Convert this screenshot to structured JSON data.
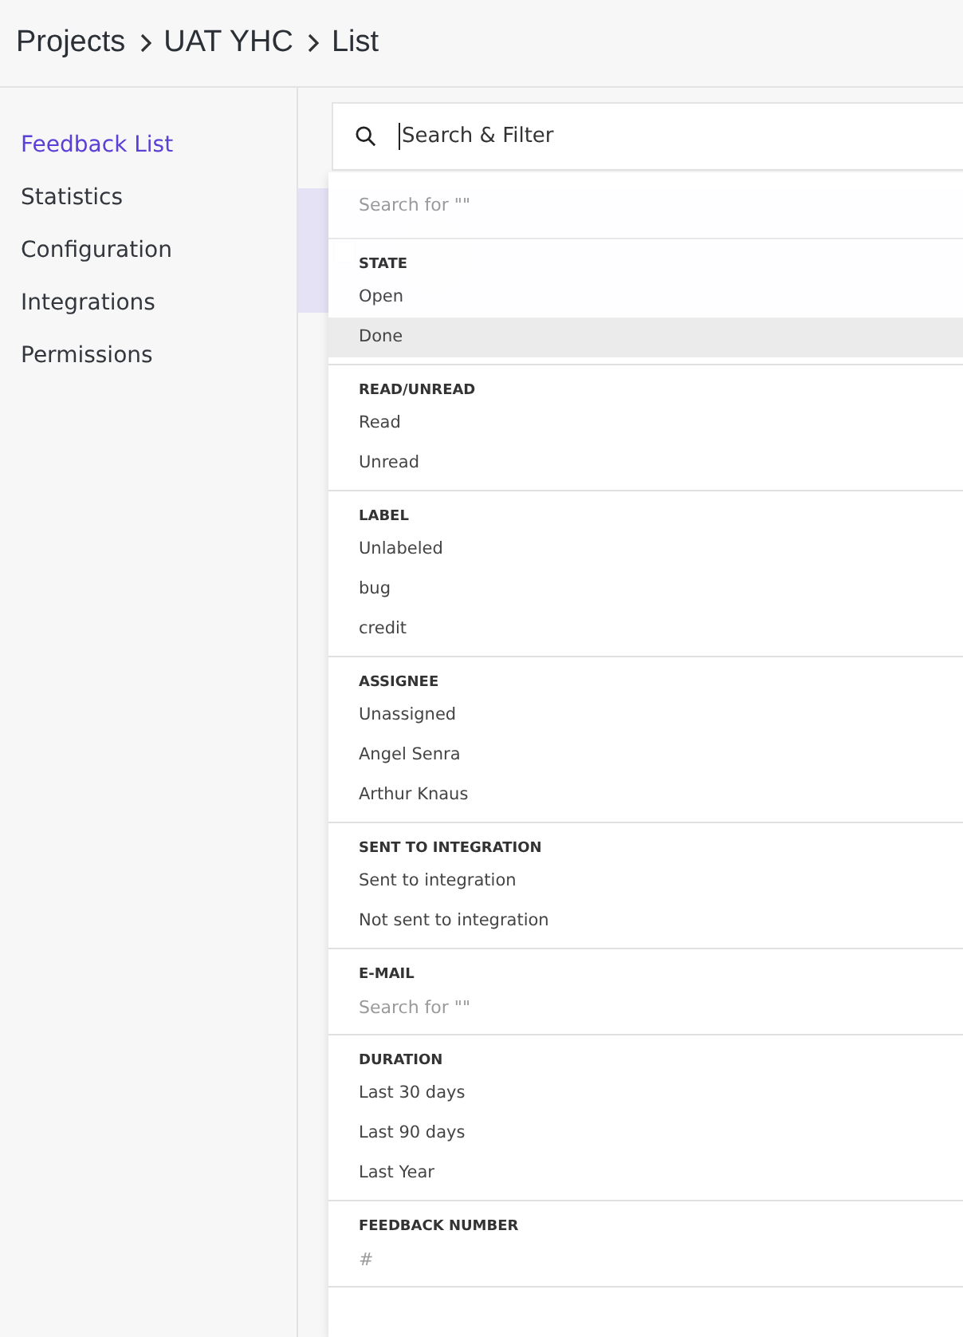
{
  "breadcrumb": [
    "Projects",
    "UAT YHC",
    "List"
  ],
  "sidebar": {
    "items": [
      {
        "label": "Feedback List",
        "selected": true
      },
      {
        "label": "Statistics",
        "selected": false
      },
      {
        "label": "Configuration",
        "selected": false
      },
      {
        "label": "Integrations",
        "selected": false
      },
      {
        "label": "Permissions",
        "selected": false
      }
    ]
  },
  "search": {
    "placeholder": "Search & Filter"
  },
  "dropdown": {
    "search_placeholder": "Search for \"\"",
    "sections": [
      {
        "title": "STATE",
        "items": [
          {
            "kind": "option",
            "label": "Open",
            "highlighted": false
          },
          {
            "kind": "option",
            "label": "Done",
            "highlighted": true
          }
        ]
      },
      {
        "title": "READ/UNREAD",
        "items": [
          {
            "kind": "option",
            "label": "Read",
            "highlighted": false
          },
          {
            "kind": "option",
            "label": "Unread",
            "highlighted": false
          }
        ]
      },
      {
        "title": "LABEL",
        "items": [
          {
            "kind": "option",
            "label": "Unlabeled",
            "highlighted": false
          },
          {
            "kind": "option",
            "label": "bug",
            "highlighted": false
          },
          {
            "kind": "option",
            "label": "credit",
            "highlighted": false
          }
        ]
      },
      {
        "title": "ASSIGNEE",
        "items": [
          {
            "kind": "option",
            "label": "Unassigned",
            "highlighted": false
          },
          {
            "kind": "option",
            "label": "Angel Senra",
            "highlighted": false
          },
          {
            "kind": "option",
            "label": "Arthur Knaus",
            "highlighted": false
          }
        ]
      },
      {
        "title": "SENT TO INTEGRATION",
        "items": [
          {
            "kind": "option",
            "label": "Sent to integration",
            "highlighted": false
          },
          {
            "kind": "option",
            "label": "Not sent to integration",
            "highlighted": false
          }
        ]
      },
      {
        "title": "E-MAIL",
        "items": [
          {
            "kind": "input",
            "placeholder": "Search for \"\""
          }
        ]
      },
      {
        "title": "DURATION",
        "items": [
          {
            "kind": "option",
            "label": "Last 30 days",
            "highlighted": false
          },
          {
            "kind": "option",
            "label": "Last 90 days",
            "highlighted": false
          },
          {
            "kind": "option",
            "label": "Last Year",
            "highlighted": false
          }
        ]
      },
      {
        "title": "FEEDBACK NUMBER",
        "items": [
          {
            "kind": "input",
            "placeholder": "#"
          }
        ]
      }
    ]
  }
}
